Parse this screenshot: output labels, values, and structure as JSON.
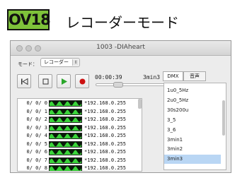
{
  "badge": "OV18",
  "heading": "レコーダーモード",
  "window": {
    "title": "1003 -DIAheart"
  },
  "mode": {
    "label": "モード：",
    "value": "レコーダー"
  },
  "transport": {
    "time_current": "00:00:39",
    "time_total": "3min3",
    "seek_fraction": 0.28
  },
  "tabs": [
    {
      "label": "DMX",
      "active": true
    },
    {
      "label": "音声",
      "active": false
    }
  ],
  "presets": [
    {
      "label": "1u0_5Hz",
      "selected": false
    },
    {
      "label": "2u0_5Hz",
      "selected": false
    },
    {
      "label": "30s200u",
      "selected": false
    },
    {
      "label": "3_5",
      "selected": false
    },
    {
      "label": "3_6",
      "selected": false
    },
    {
      "label": "3min1",
      "selected": false
    },
    {
      "label": "3min2",
      "selected": false
    },
    {
      "label": "3min3",
      "selected": true
    }
  ],
  "channels": [
    {
      "num": "0/ 0/ 0",
      "ip": "*192.168.0.255"
    },
    {
      "num": "0/ 0/ 1",
      "ip": "*192.168.0.255"
    },
    {
      "num": "0/ 0/ 2",
      "ip": "*192.168.0.255"
    },
    {
      "num": "0/ 0/ 3",
      "ip": "*192.168.0.255"
    },
    {
      "num": "0/ 0/ 4",
      "ip": "*192.168.0.255"
    },
    {
      "num": "0/ 0/ 5",
      "ip": "*192.168.0.255"
    },
    {
      "num": "0/ 0/ 6",
      "ip": "*192.168.0.255"
    },
    {
      "num": "0/ 0/ 7",
      "ip": "*192.168.0.255"
    },
    {
      "num": "0/ 0/ 8",
      "ip": "*192.168.0.255"
    }
  ],
  "colors": {
    "badge": "#7ec23a",
    "waveform": "#3ad43a",
    "play": "#2aa62a",
    "record": "#cc1111",
    "selection": "#b9d6f4"
  }
}
